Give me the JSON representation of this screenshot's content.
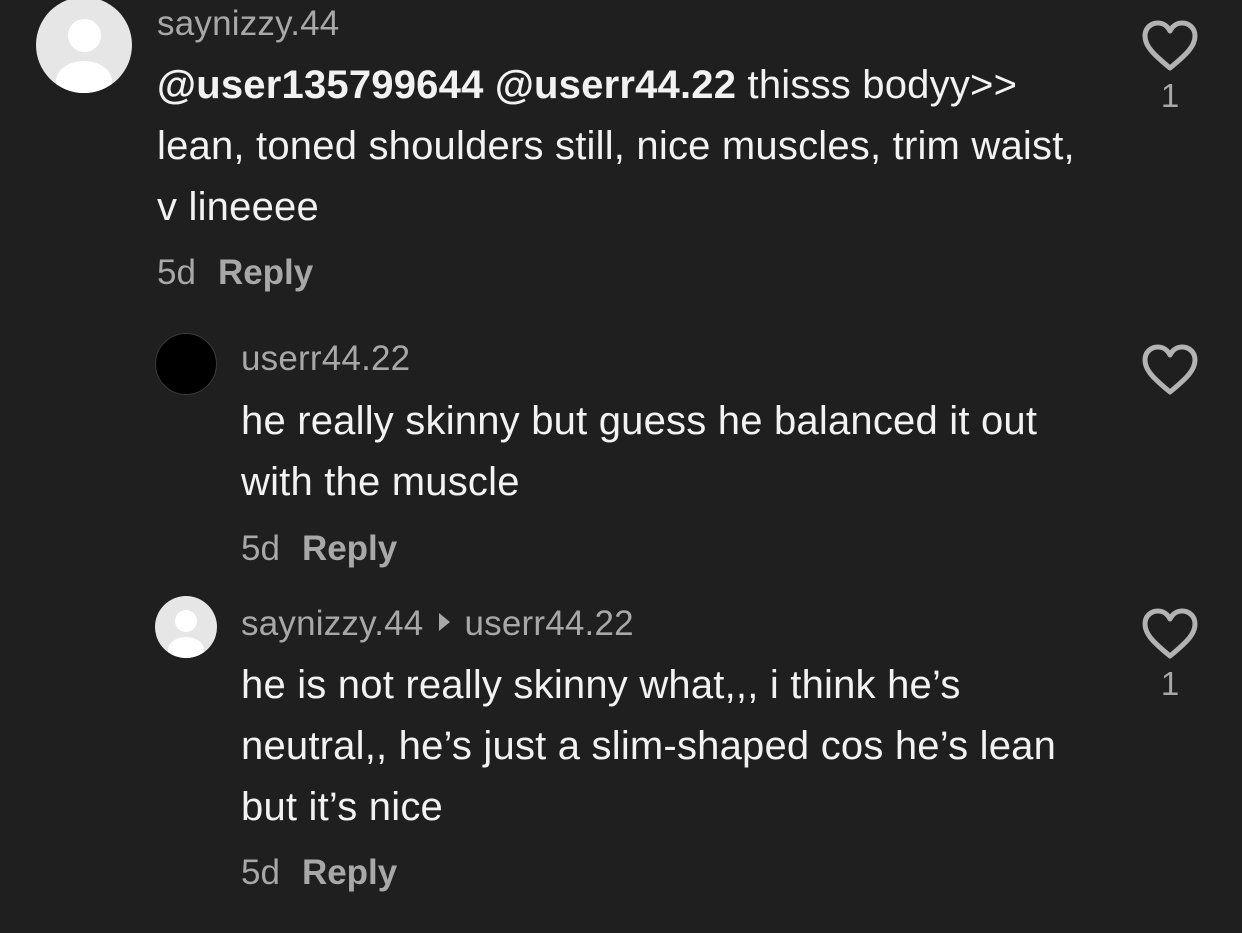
{
  "comments": [
    {
      "username": "saynizzy.44",
      "mention1": "@user135799644",
      "mention2": "@userr44.22",
      "text_line1": " thisss bodyy>>",
      "text_rest": "lean, toned shoulders still, nice muscles, trim waist, v lineeee",
      "age": "5d",
      "reply_label": "Reply",
      "likes": "1"
    },
    {
      "username": "userr44.22",
      "text": "he really skinny but guess he balanced it out with the muscle",
      "age": "5d",
      "reply_label": "Reply"
    },
    {
      "username": "saynizzy.44",
      "reply_to": "userr44.22",
      "text": "he is not really skinny what,,, i think he’s neutral,, he’s just a slim-shaped cos he’s lean but it’s nice",
      "age": "5d",
      "reply_label": "Reply",
      "likes": "1"
    }
  ],
  "icons": {
    "avatar_default": "default-avatar-icon",
    "like": "heart-outline-icon",
    "reply_arrow": "play-arrow-icon"
  },
  "colors": {
    "background": "#1f1f1f",
    "primary_text": "#f2f2f2",
    "secondary_text": "#a8a8a8"
  }
}
